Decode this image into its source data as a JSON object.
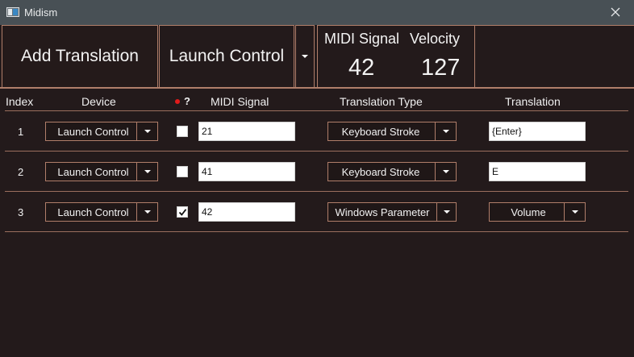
{
  "window": {
    "title": "Midism",
    "close_icon": "close-icon",
    "app_icon": "window-app-icon"
  },
  "header": {
    "add_translation_label": "Add Translation",
    "device_selected": "Launch Control",
    "midi_signal_label": "MIDI Signal",
    "midi_signal_value": "42",
    "velocity_label": "Velocity",
    "velocity_value": "127"
  },
  "columns": {
    "index": "Index",
    "device": "Device",
    "enabled_symbol": "?",
    "midi_signal": "MIDI Signal",
    "translation_type": "Translation Type",
    "translation": "Translation"
  },
  "colors": {
    "background": "#231a1b",
    "titlebar": "#485055",
    "accent_border": "#b07e6a",
    "record_dot": "#e11b1b"
  },
  "rows": [
    {
      "index": "1",
      "device": "Launch Control",
      "checked": false,
      "midi_signal": "21",
      "translation_type": "Keyboard Stroke",
      "translation_kind": "text",
      "translation": "{Enter}"
    },
    {
      "index": "2",
      "device": "Launch Control",
      "checked": false,
      "midi_signal": "41",
      "translation_type": "Keyboard Stroke",
      "translation_kind": "text",
      "translation": "E"
    },
    {
      "index": "3",
      "device": "Launch Control",
      "checked": true,
      "midi_signal": "42",
      "translation_type": "Windows Parameter",
      "translation_kind": "dropdown",
      "translation": "Volume"
    }
  ]
}
